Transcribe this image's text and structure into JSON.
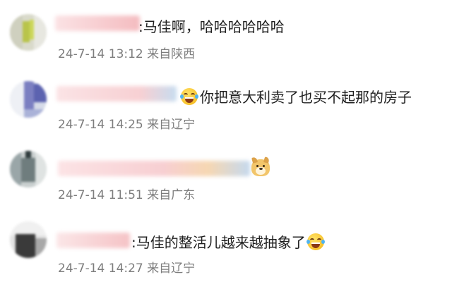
{
  "comments": [
    {
      "text": ":马佳啊，哈哈哈哈哈哈",
      "time": "24-7-14 13:12",
      "source": "来自陕西",
      "emoji_before": "",
      "emoji_after": ""
    },
    {
      "text": "你把意大利卖了也买不起那的房子",
      "time": "24-7-14 14:25",
      "source": "来自辽宁",
      "emoji_before": "laughing-with-tears-icon",
      "emoji_after": ""
    },
    {
      "text": "",
      "time": "24-7-14 11:51",
      "source": "来自广东",
      "emoji_before": "",
      "emoji_after": "doge-icon"
    },
    {
      "text": ":马佳的整活儿越来越抽象了",
      "time": "24-7-14 14:27",
      "source": "来自辽宁",
      "emoji_before": "",
      "emoji_after": "laughing-with-tears-icon"
    }
  ],
  "colors": {
    "comment_text": "#1f1f1f",
    "meta_text": "#7d7d7d",
    "name_blur": "#f6c9cc",
    "background": "#ffffff"
  }
}
